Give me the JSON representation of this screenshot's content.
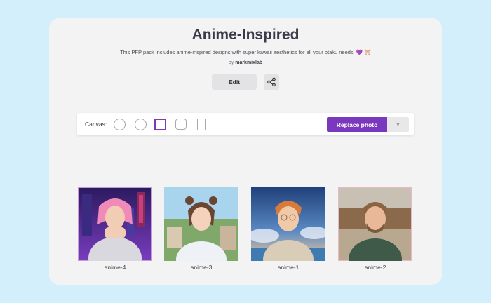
{
  "header": {
    "title": "Anime-Inspired",
    "description": "This PFP pack includes anime-inspired designs with super kawaii aesthetics for all your otaku needs!",
    "description_emoji_1": "💜",
    "description_emoji_2": "⛩",
    "byline_prefix": "by",
    "author": "markmixlab"
  },
  "actions": {
    "edit_label": "Edit",
    "share_icon": "share-icon"
  },
  "toolbar": {
    "canvas_label": "Canvas:",
    "shapes": [
      "circle",
      "circle-outline",
      "square",
      "rounded-square",
      "portrait-rect"
    ],
    "selected_shape": "square",
    "replace_label": "Replace photo",
    "dropdown_icon": "chevron-down-icon",
    "accent_color": "#7a38be"
  },
  "gallery": [
    {
      "label": "anime-4",
      "frame_color": "#c49ad8"
    },
    {
      "label": "anime-3",
      "frame_color": "none"
    },
    {
      "label": "anime-1",
      "frame_color": "none"
    },
    {
      "label": "anime-2",
      "frame_color": "#e6b9c6"
    }
  ]
}
